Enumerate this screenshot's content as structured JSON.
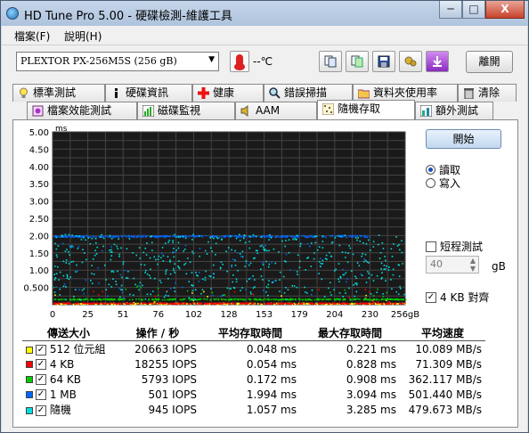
{
  "window": {
    "title": "HD Tune Pro  5.00 - 硬碟檢測-維護工具",
    "minimize": "─",
    "maximize": "□",
    "close": "X"
  },
  "menu": {
    "file": "檔案(F)",
    "help": "說明(H)"
  },
  "toolbar": {
    "drive": "PLEXTOR PX-256M5S (256 gB)",
    "temperature": "--℃",
    "exit": "離開",
    "icons": [
      "thermometer-icon",
      "copy-text-icon",
      "copy-screenshot-icon",
      "save-icon",
      "options-icon",
      "download-icon"
    ]
  },
  "tabs_row1": [
    {
      "label": "標準測試",
      "icon": "bulb-icon"
    },
    {
      "label": "硬碟資訊",
      "icon": "info-icon"
    },
    {
      "label": "健康",
      "icon": "health-cross-icon"
    },
    {
      "label": "錯誤掃描",
      "icon": "magnifier-icon"
    },
    {
      "label": "資料夾使用率",
      "icon": "folder-icon"
    },
    {
      "label": "清除",
      "icon": "trash-icon"
    }
  ],
  "tabs_row2": [
    {
      "label": "檔案效能測試",
      "icon": "file-benchmark-icon"
    },
    {
      "label": "磁碟監視",
      "icon": "monitor-chart-icon"
    },
    {
      "label": "AAM",
      "icon": "speaker-icon"
    },
    {
      "label": "隨機存取",
      "icon": "random-access-icon",
      "active": true
    },
    {
      "label": "額外測試",
      "icon": "extra-tests-icon"
    }
  ],
  "controls": {
    "start": "開始",
    "read": "讀取",
    "write": "寫入",
    "short_test": "短程測試",
    "short_value": "40",
    "short_unit": "gB",
    "align_4kb": "4 KB 對齊"
  },
  "chart_data": {
    "type": "scatter",
    "ylabel": "ms",
    "ylim": [
      0,
      5
    ],
    "yticks": [
      "5.00",
      "4.50",
      "4.00",
      "3.50",
      "3.00",
      "2.50",
      "2.00",
      "1.50",
      "1.00",
      "0.500"
    ],
    "xlim": [
      0,
      256
    ],
    "xticks": [
      "0",
      "25",
      "51",
      "76",
      "102",
      "128",
      "153",
      "179",
      "204",
      "230",
      "256gB"
    ],
    "series": [
      {
        "name": "512 位元組",
        "color": "#ffff00",
        "level_ms": 0.048
      },
      {
        "name": "4 KB",
        "color": "#ff0000",
        "level_ms": 0.054
      },
      {
        "name": "64 KB",
        "color": "#00cc00",
        "level_ms": 0.172
      },
      {
        "name": "1 MB",
        "color": "#0066ff",
        "level_ms": 1.994
      },
      {
        "name": "隨機",
        "color": "#00dddd",
        "level_ms": 1.057
      }
    ]
  },
  "results": {
    "headers": [
      "傳送大小",
      "操作 / 秒",
      "平均存取時間",
      "最大存取時間",
      "平均速度"
    ],
    "rows": [
      {
        "size": "512 位元組",
        "color": "#ffff00",
        "iops": "20663 IOPS",
        "avg": "0.048 ms",
        "max": "0.221 ms",
        "speed": "10.089 MB/s"
      },
      {
        "size": "4 KB",
        "color": "#ff0000",
        "iops": "18255 IOPS",
        "avg": "0.054 ms",
        "max": "0.828 ms",
        "speed": "71.309 MB/s"
      },
      {
        "size": "64 KB",
        "color": "#00cc00",
        "iops": "5793 IOPS",
        "avg": "0.172 ms",
        "max": "0.908 ms",
        "speed": "362.117 MB/s"
      },
      {
        "size": "1 MB",
        "color": "#0066ff",
        "iops": "501 IOPS",
        "avg": "1.994 ms",
        "max": "3.094 ms",
        "speed": "501.440 MB/s"
      },
      {
        "size": "隨機",
        "color": "#00dddd",
        "iops": "945 IOPS",
        "avg": "1.057 ms",
        "max": "3.285 ms",
        "speed": "479.673 MB/s"
      }
    ]
  }
}
